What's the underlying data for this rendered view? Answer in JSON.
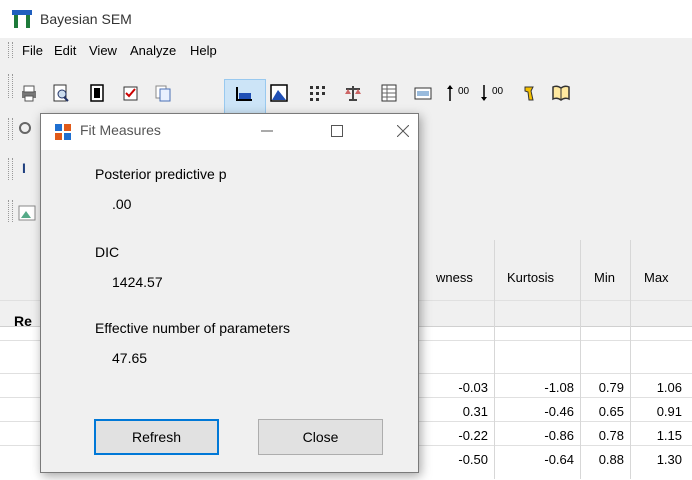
{
  "window": {
    "title": "Bayesian SEM"
  },
  "menu": [
    "File",
    "Edit",
    "View",
    "Analyze",
    "Help"
  ],
  "toolbar": {
    "text_00_up": "00",
    "text_00_down": "00"
  },
  "left_strip": {
    "row3": "I",
    "row5": "Re"
  },
  "table": {
    "columns": [
      "wness",
      "Kurtosis",
      "Min",
      "Max"
    ],
    "rows": [
      [
        "-0.03",
        "-1.08",
        "0.79",
        "1.06"
      ],
      [
        "0.31",
        "-0.46",
        "0.65",
        "0.91"
      ],
      [
        "-0.22",
        "-0.86",
        "0.78",
        "1.15"
      ],
      [
        "-0.50",
        "-0.64",
        "0.88",
        "1.30"
      ]
    ]
  },
  "dialog": {
    "title": "Fit Measures",
    "posterior_label": "Posterior predictive p",
    "posterior_value": ".00",
    "dic_label": "DIC",
    "dic_value": "1424.57",
    "enp_label": "Effective number of parameters",
    "enp_value": "47.65",
    "refresh_label": "Refresh",
    "close_label": "Close"
  },
  "colors": {
    "accent": "#0078d7",
    "selected_tool": "#cce4f7"
  }
}
